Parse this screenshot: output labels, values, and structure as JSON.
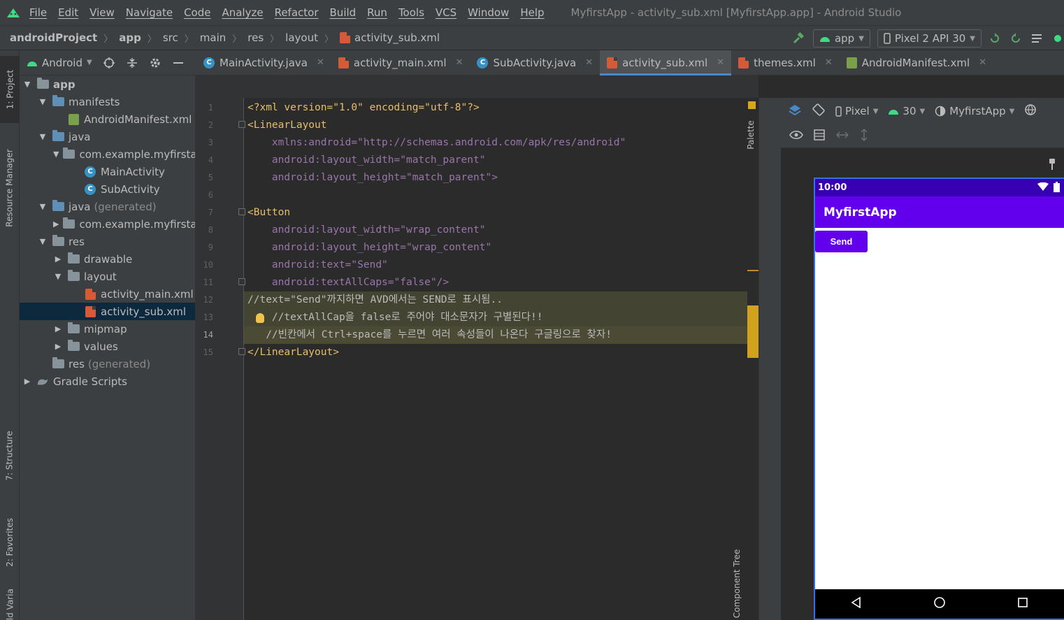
{
  "menubar": {
    "items": [
      "File",
      "Edit",
      "View",
      "Navigate",
      "Code",
      "Analyze",
      "Refactor",
      "Build",
      "Run",
      "Tools",
      "VCS",
      "Window",
      "Help"
    ],
    "window_title": "MyfirstApp - activity_sub.xml [MyfirstApp.app] - Android Studio"
  },
  "breadcrumb": [
    "androidProject",
    "app",
    "src",
    "main",
    "res",
    "layout",
    "activity_sub.xml"
  ],
  "run_config": {
    "module": "app",
    "device": "Pixel 2 API 30"
  },
  "left_strip": {
    "project": "1: Project",
    "resource_manager": "Resource Manager",
    "structure": "7: Structure",
    "favorites": "2: Favorites",
    "variants": "Build Variants"
  },
  "project_panel": {
    "view_mode": "Android",
    "tree": [
      {
        "label": "app",
        "level": 0,
        "expanded": true,
        "icon": "module-folder-icon"
      },
      {
        "label": "manifests",
        "level": 1,
        "expanded": true,
        "icon": "folder-icon"
      },
      {
        "label": "AndroidManifest.xml",
        "level": 2,
        "icon": "manifest-file-icon"
      },
      {
        "label": "java",
        "level": 1,
        "expanded": true,
        "icon": "folder-icon"
      },
      {
        "label": "com.example.myfirstap",
        "level": 2,
        "expanded": true,
        "icon": "package-icon"
      },
      {
        "label": "MainActivity",
        "level": 3,
        "icon": "class-icon"
      },
      {
        "label": "SubActivity",
        "level": 3,
        "icon": "class-icon"
      },
      {
        "label": "java",
        "suffix": "(generated)",
        "level": 1,
        "expanded": true,
        "icon": "generated-folder-icon"
      },
      {
        "label": "com.example.myfirstap",
        "level": 2,
        "expanded": false,
        "icon": "package-icon"
      },
      {
        "label": "res",
        "level": 1,
        "expanded": true,
        "icon": "res-folder-icon"
      },
      {
        "label": "drawable",
        "level": 2,
        "expanded": false,
        "icon": "folder-icon"
      },
      {
        "label": "layout",
        "level": 2,
        "expanded": true,
        "icon": "folder-icon"
      },
      {
        "label": "activity_main.xml",
        "level": 3,
        "icon": "xml-file-icon"
      },
      {
        "label": "activity_sub.xml",
        "level": 3,
        "icon": "xml-file-icon",
        "selected": true
      },
      {
        "label": "mipmap",
        "level": 2,
        "expanded": false,
        "icon": "folder-icon"
      },
      {
        "label": "values",
        "level": 2,
        "expanded": false,
        "icon": "folder-icon"
      },
      {
        "label": "res",
        "suffix": "(generated)",
        "level": 1,
        "icon": "res-folder-icon"
      },
      {
        "label": "Gradle Scripts",
        "level": 0,
        "expanded": false,
        "icon": "gradle-icon"
      }
    ]
  },
  "tabs": [
    {
      "label": "MainActivity.java",
      "icon": "class-icon",
      "active": false
    },
    {
      "label": "activity_main.xml",
      "icon": "xml-file-icon",
      "active": false
    },
    {
      "label": "SubActivity.java",
      "icon": "class-icon",
      "active": false
    },
    {
      "label": "activity_sub.xml",
      "icon": "xml-file-icon",
      "active": true
    },
    {
      "label": "themes.xml",
      "icon": "xml-file-icon",
      "active": false
    },
    {
      "label": "AndroidManifest.xml",
      "icon": "manifest-file-icon",
      "active": false
    }
  ],
  "editor": {
    "current_line": 14,
    "lines": [
      "<?xml version=\"1.0\" encoding=\"utf-8\"?>",
      "<LinearLayout",
      "    xmlns:android=\"http://schemas.android.com/apk/res/android\"",
      "    android:layout_width=\"match_parent\"",
      "    android:layout_height=\"match_parent\">",
      "",
      "<Button",
      "    android:layout_width=\"wrap_content\"",
      "    android:layout_height=\"wrap_content\"",
      "    android:text=\"Send\"",
      "    android:textAllCaps=\"false\"/>",
      "//text=\"Send\"까지하면 AVD에서는 SEND로 표시됨..",
      "    //textAllCap을 false로 주어야 대소문자가 구별된다!!",
      "   //빈칸에서 Ctrl+space를 누르면 여러 속성들이 나온다 구글링으로 찾자!",
      "</LinearLayout>"
    ]
  },
  "design_panel": {
    "palette_label": "Palette",
    "component_tree_label": "Component Tree",
    "device": "Pixel",
    "api": "30",
    "theme": "MyfirstApp"
  },
  "preview": {
    "time": "10:00",
    "app_title": "MyfirstApp",
    "button_label": "Send",
    "colors": {
      "status_bar": "#3700b3",
      "app_bar": "#6200ee",
      "button": "#6200ee"
    }
  }
}
